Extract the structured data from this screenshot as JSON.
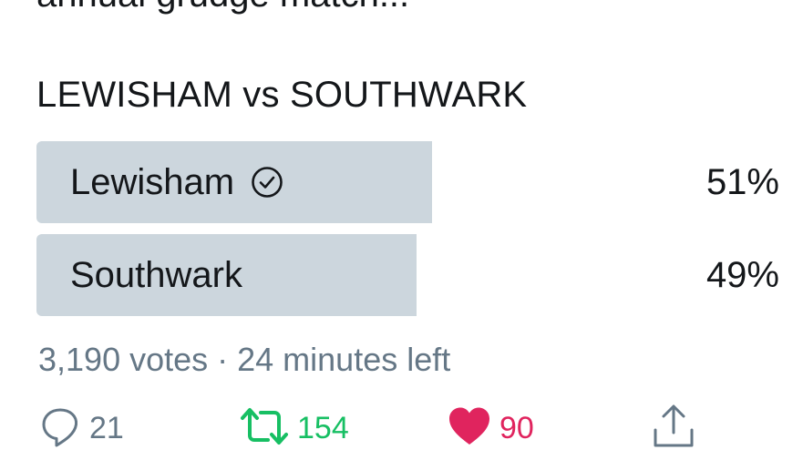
{
  "tweet": {
    "cut_text": "annual grudge match..."
  },
  "poll": {
    "question": "LEWISHAM vs SOUTHWARK",
    "options": [
      {
        "label": "Lewisham",
        "percent": "51%",
        "value": 51,
        "selected": true
      },
      {
        "label": "Southwark",
        "percent": "49%",
        "value": 49,
        "selected": false
      }
    ],
    "meta": "3,190 votes · 24 minutes left"
  },
  "actions": {
    "reply_count": "21",
    "retweet_count": "154",
    "like_count": "90",
    "reply_icon": "speech-bubble-icon",
    "retweet_icon": "retweet-arrows-icon",
    "like_icon": "heart-icon",
    "share_icon": "share-upload-icon"
  },
  "colors": {
    "bar": "#ccd6dd",
    "meta_text": "#657786",
    "retweet_green": "#17bf63",
    "like_red": "#e0245e",
    "text": "#14171a"
  }
}
